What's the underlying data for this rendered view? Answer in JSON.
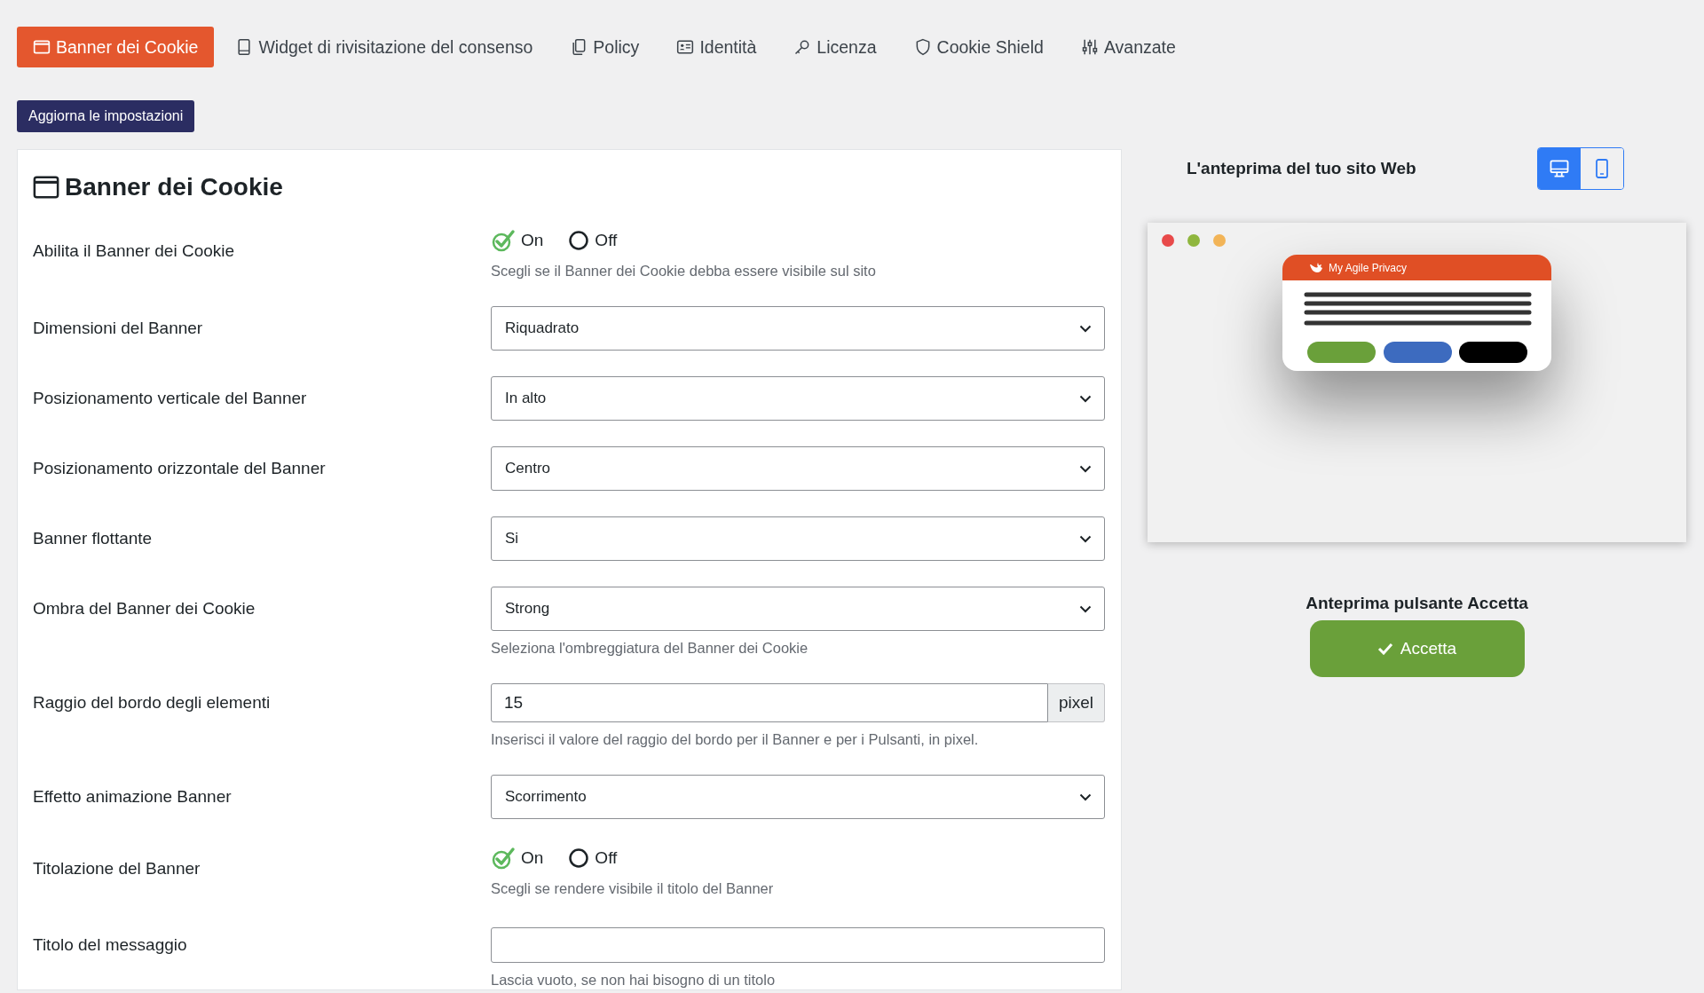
{
  "tabs": [
    {
      "label": "Banner dei Cookie",
      "kind": "window",
      "selected": true
    },
    {
      "label": "Widget di rivisitazione del consenso",
      "kind": "tablet",
      "selected": false
    },
    {
      "label": "Policy",
      "kind": "copy",
      "selected": false
    },
    {
      "label": "Identità",
      "kind": "idcard",
      "selected": false
    },
    {
      "label": "Licenza",
      "kind": "key",
      "selected": false
    },
    {
      "label": "Cookie Shield",
      "kind": "shield",
      "selected": false
    },
    {
      "label": "Avanzate",
      "kind": "sliders",
      "selected": false
    }
  ],
  "update_button": "Aggiorna le impostazioni",
  "panel": {
    "title": "Banner dei Cookie",
    "fields": [
      {
        "kind": "radio",
        "label": "Abilita il Banner dei Cookie",
        "options": [
          {
            "label": "On",
            "selected": true
          },
          {
            "label": "Off",
            "selected": false
          }
        ],
        "hint": "Scegli se il Banner dei Cookie debba essere visibile sul sito"
      },
      {
        "kind": "select",
        "label": "Dimensioni del Banner",
        "value": "Riquadrato"
      },
      {
        "kind": "select",
        "label": "Posizionamento verticale del Banner",
        "value": "In alto"
      },
      {
        "kind": "select",
        "label": "Posizionamento orizzontale del Banner",
        "value": "Centro"
      },
      {
        "kind": "select",
        "label": "Banner flottante",
        "value": "Si"
      },
      {
        "kind": "select",
        "label": "Ombra del Banner dei Cookie",
        "value": "Strong",
        "hint": "Seleziona l'ombreggiatura del Banner dei Cookie"
      },
      {
        "kind": "number",
        "label": "Raggio del bordo degli elementi",
        "value": "15",
        "unit": "pixel",
        "hint": "Inserisci il valore del raggio del bordo per il Banner e per i Pulsanti, in pixel."
      },
      {
        "kind": "select",
        "label": "Effetto animazione Banner",
        "value": "Scorrimento"
      },
      {
        "kind": "radio",
        "label": "Titolazione del Banner",
        "options": [
          {
            "label": "On",
            "selected": true
          },
          {
            "label": "Off",
            "selected": false
          }
        ],
        "hint": "Scegli se rendere visibile il titolo del Banner"
      },
      {
        "kind": "text",
        "label": "Titolo del messaggio",
        "hint": "Lascia vuoto, se non hai bisogno di un titolo"
      }
    ]
  },
  "preview": {
    "title": "L'anteprima del tuo sito Web",
    "devices": [
      {
        "kind": "desktop",
        "selected": true
      },
      {
        "kind": "mobile",
        "selected": false
      }
    ],
    "banner_brand": "My Agile Privacy",
    "accept_title": "Anteprima pulsante Accetta",
    "accept_button": "Accetta"
  }
}
